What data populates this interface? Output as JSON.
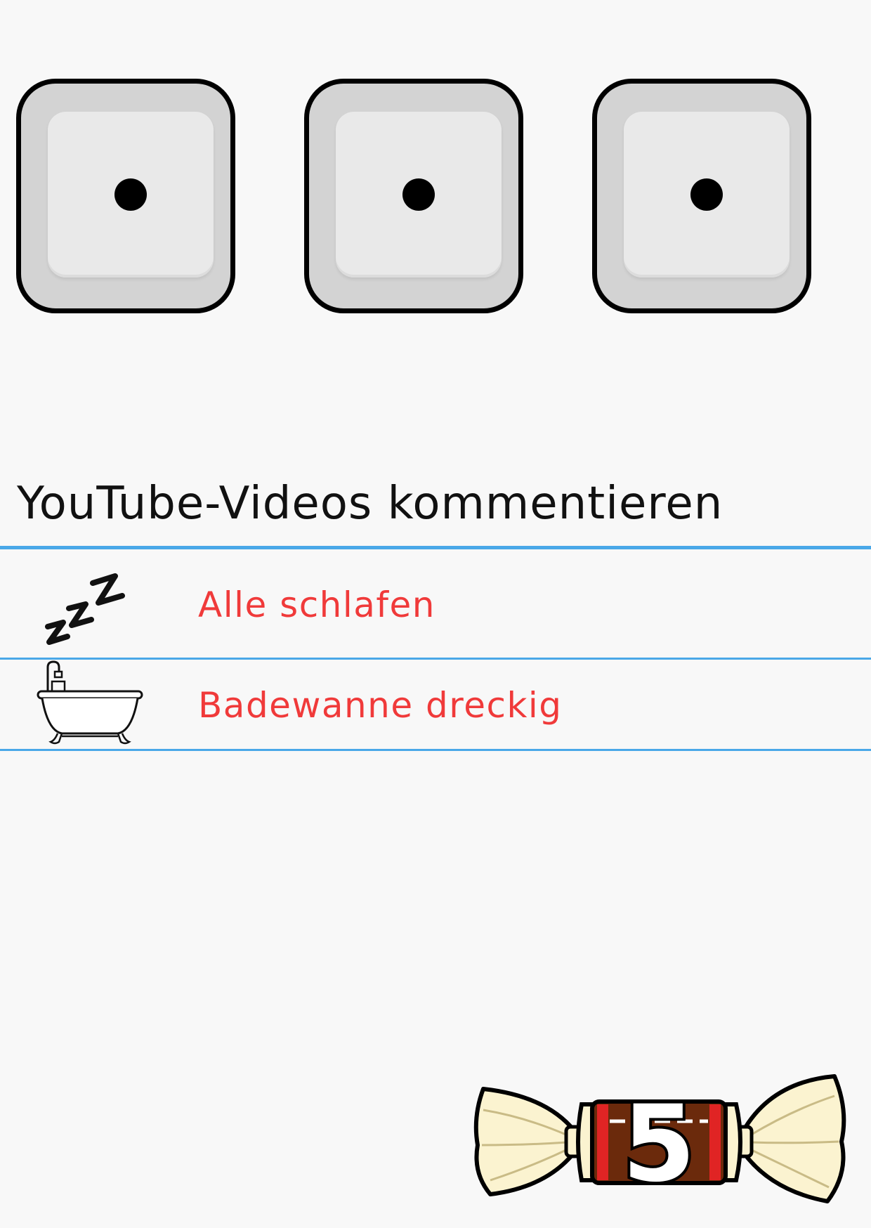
{
  "dice": [
    {
      "value": 1
    },
    {
      "value": 1
    },
    {
      "value": 1
    }
  ],
  "card": {
    "title": "YouTube-Videos kommentieren",
    "items": [
      {
        "icon": "zzz-icon",
        "label": "Alle schlafen"
      },
      {
        "icon": "bathtub-icon",
        "label": "Badewanne dreckig"
      }
    ]
  },
  "badge": {
    "number": "5",
    "icon": "candy-icon"
  },
  "colors": {
    "accent_line": "#4aa8e8",
    "item_text": "#f03a3a",
    "candy_brown": "#6b2a0c",
    "candy_red": "#e02424",
    "wrapper": "#fbf3d0"
  }
}
